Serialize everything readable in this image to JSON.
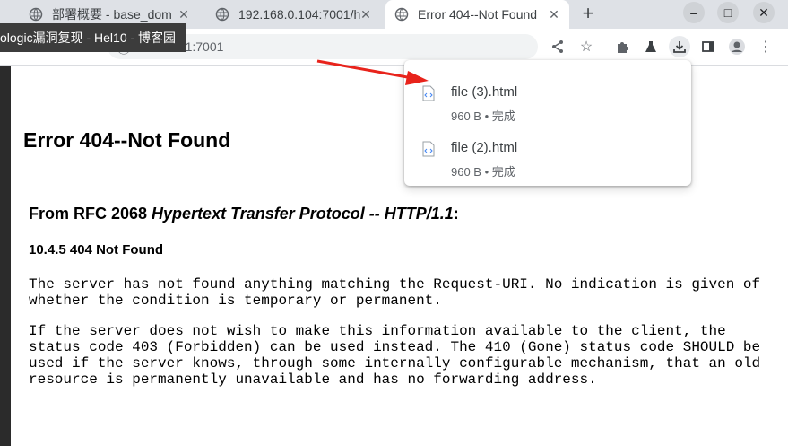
{
  "tabs": [
    {
      "title": "部署概要 - base_dom",
      "active": false
    },
    {
      "title": "192.168.0.104:7001/h",
      "active": false
    },
    {
      "title": "Error 404--Not Found",
      "active": true
    }
  ],
  "tooltip": "ologic漏洞复现 - Hel10 - 博客园",
  "address_bar": {
    "url": "127.0.0.1:7001"
  },
  "downloads": [
    {
      "filename": "file (3).html",
      "status": "960 B • 完成"
    },
    {
      "filename": "file (2).html",
      "status": "960 B • 完成"
    }
  ],
  "page": {
    "heading": "Error 404--Not Found",
    "rfc_prefix": "From RFC 2068 ",
    "rfc_title": "Hypertext Transfer Protocol -- HTTP/1.1",
    "rfc_suffix": ":",
    "section": "10.4.5 404 Not Found",
    "para1": "The server has not found anything matching the Request-URI. No indication is given of\nwhether the condition is temporary or permanent.",
    "para2": "If the server does not wish to make this information available to the client, the\nstatus code 403 (Forbidden) can be used instead. The 410 (Gone) status code SHOULD be\nused if the server knows, through some internally configurable mechanism, that an old\nresource is permanently unavailable and has no forwarding address."
  },
  "colors": {
    "annotation_arrow": "#e8231b",
    "tab_strip": "#dee1e6"
  }
}
